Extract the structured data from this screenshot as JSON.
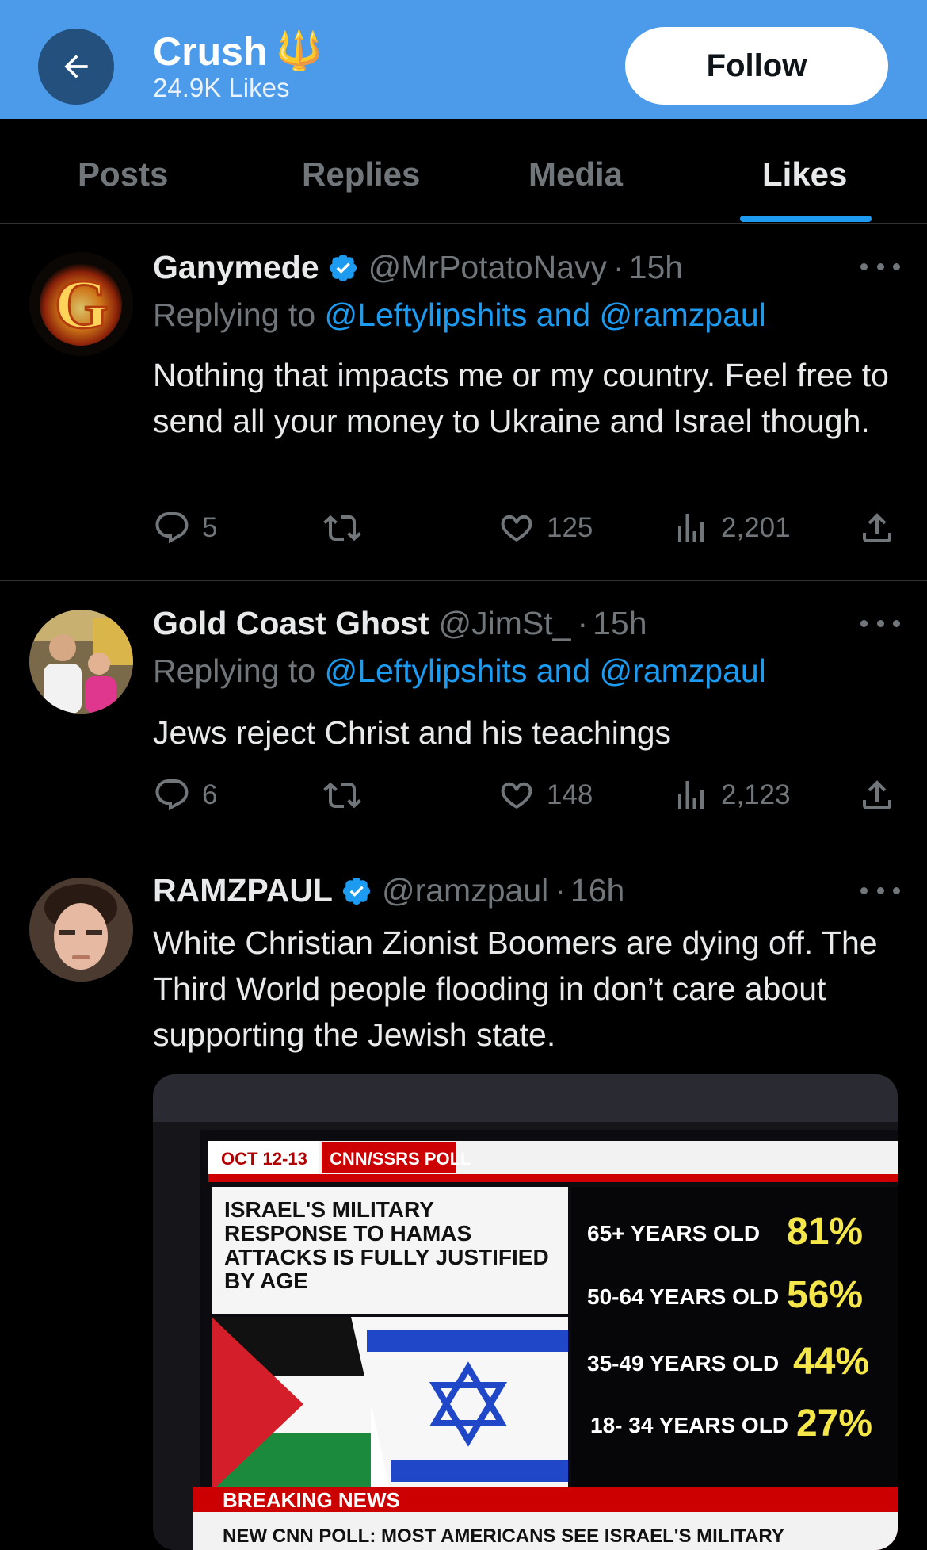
{
  "profile": {
    "name": "Crush",
    "emoji": "🔱",
    "likes_count": "24.9K Likes",
    "follow_label": "Follow"
  },
  "tabs": [
    {
      "label": "Posts",
      "active": false
    },
    {
      "label": "Replies",
      "active": false
    },
    {
      "label": "Media",
      "active": false
    },
    {
      "label": "Likes",
      "active": true
    }
  ],
  "tweets": [
    {
      "name": "Ganymede",
      "verified": true,
      "handle": "@MrPotatoNavy",
      "time": "15h",
      "replying_prefix": "Replying to",
      "replying_to": "@Leftylipshits and @ramzpaul",
      "text": "Nothing that impacts me or my country. Feel free to send all your money to Ukraine and Israel though.",
      "replies": "5",
      "retweets": "",
      "likes": "125",
      "views": "2,201"
    },
    {
      "name": "Gold Coast Ghost",
      "verified": false,
      "handle": "@JimSt_",
      "time": "15h",
      "replying_prefix": "Replying to",
      "replying_to": "@Leftylipshits and @ramzpaul",
      "text": "Jews reject Christ and his teachings",
      "replies": "6",
      "retweets": "",
      "likes": "148",
      "views": "2,123"
    },
    {
      "name": "RAMZPAUL",
      "verified": true,
      "handle": "@ramzpaul",
      "time": "16h",
      "text": "White Christian Zionist Boomers are dying off. The Third World people flooding in don’t care about supporting the Jewish state."
    }
  ],
  "media": {
    "date_tag": "OCT 12-13",
    "poll_tag": "CNN/SSRS POLL",
    "headline": "ISRAEL'S MILITARY RESPONSE TO HAMAS ATTACKS IS FULLY JUSTIFIED BY AGE",
    "rows": [
      {
        "label": "65+ YEARS OLD",
        "value": "81%"
      },
      {
        "label": "50-64 YEARS OLD",
        "value": "56%"
      },
      {
        "label": "35-49 YEARS OLD",
        "value": "44%"
      },
      {
        "label": "18- 34 YEARS OLD",
        "value": "27%"
      }
    ],
    "breaking": "BREAKING NEWS",
    "ticker": "NEW CNN POLL: MOST AMERICANS SEE ISRAEL'S MILITARY"
  },
  "colors": {
    "header_bg": "#4c9aea",
    "accent": "#1d9bf0",
    "text_primary": "#e7e9ea",
    "text_secondary": "#71767b"
  }
}
